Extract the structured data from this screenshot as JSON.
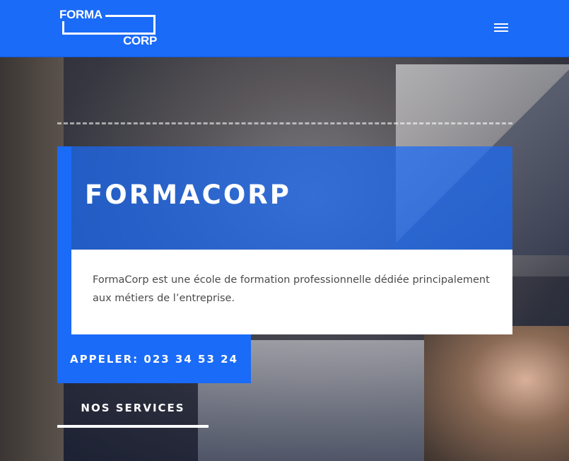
{
  "header": {
    "logo_top": "FORMA",
    "logo_bottom": "CORP",
    "menu_icon": "hamburger-menu-icon",
    "background_color": "#1a6bf7"
  },
  "hero": {
    "title": "FORMACORP",
    "description": "FormaCorp est une école de formation professionnelle dédiée principalement aux métiers de l’entreprise.",
    "call_button_label": "APPELER: 023 34 53 24",
    "services_link_label": "NOS SERVICES",
    "accent_color": "#1a6bf7"
  }
}
